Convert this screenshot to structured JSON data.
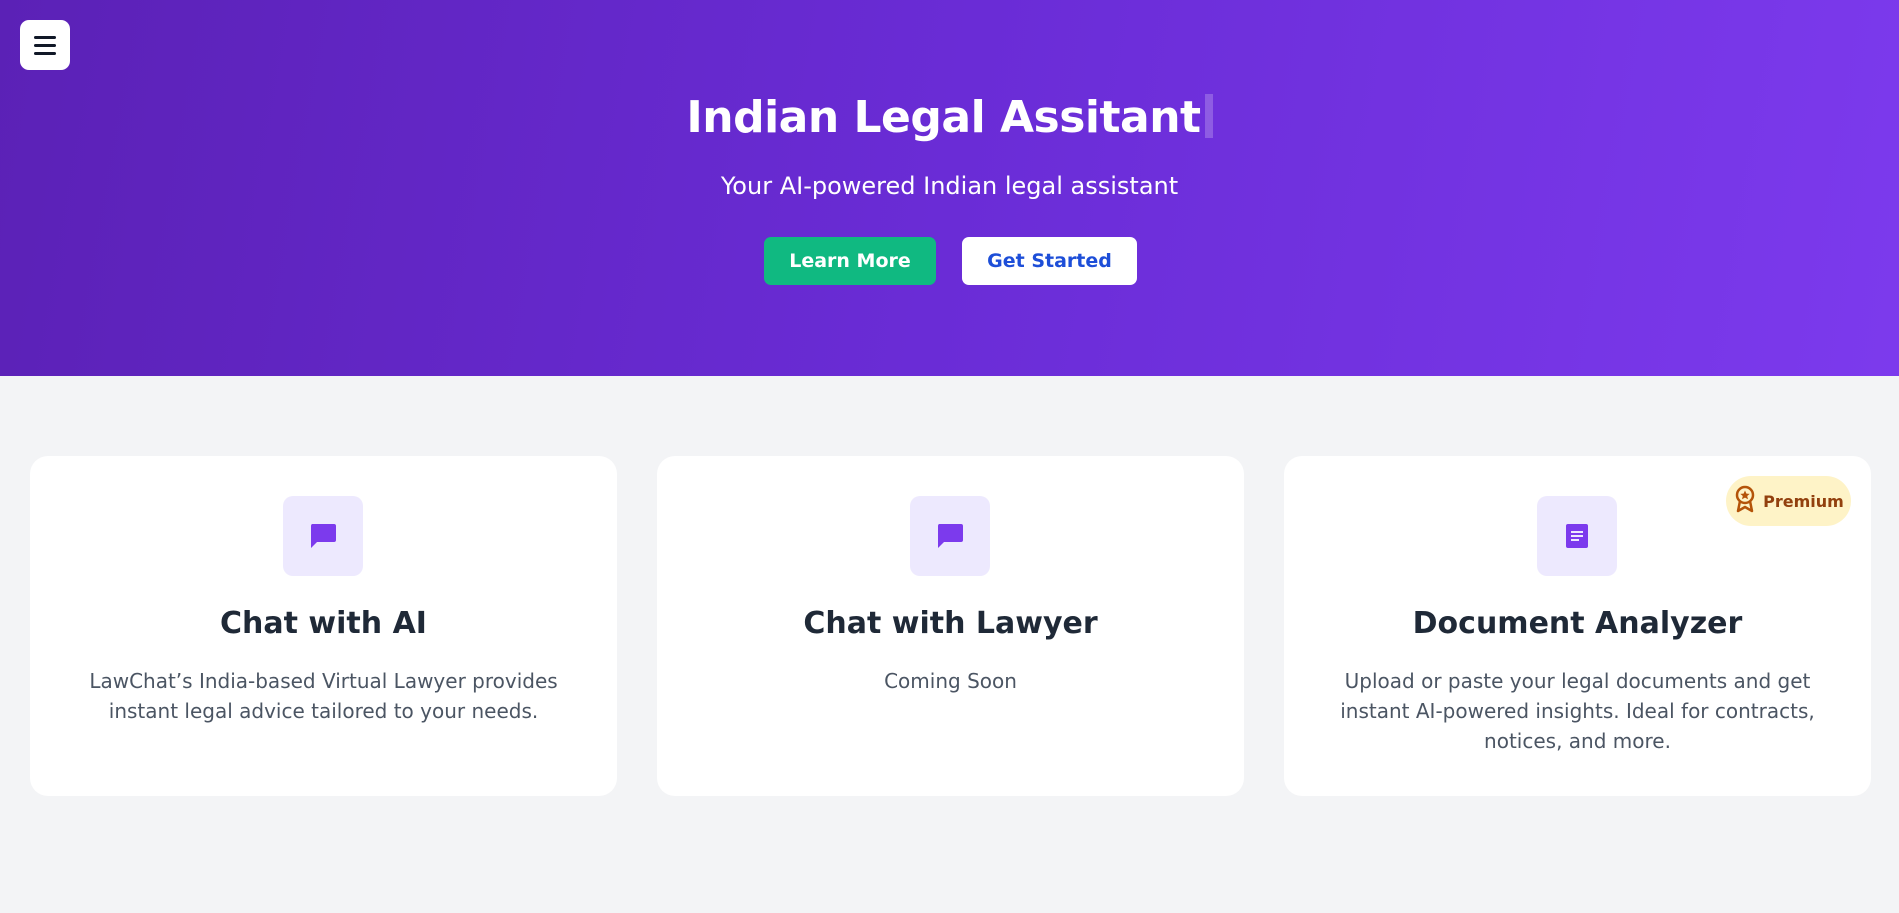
{
  "header": {
    "menu_icon": "hamburger-menu-icon",
    "title": "Indian Legal Assitant",
    "subtitle": "Your AI-powered Indian legal assistant",
    "learn_more_label": "Learn More",
    "get_started_label": "Get Started"
  },
  "colors": {
    "hero_gradient_start": "#5b21b6",
    "hero_gradient_end": "#7c3aed",
    "learn_more_bg": "#10b981",
    "get_started_text": "#1d4ed8",
    "icon_bg": "#ede9fe",
    "icon_color": "#7c3aed",
    "premium_bg": "#fef3c7",
    "premium_text": "#92400e"
  },
  "cards": [
    {
      "icon": "chat-bubble-icon",
      "title": "Chat with AI",
      "description_lines": [
        "LawChat’s India-based Virtual Lawyer provides",
        "instant legal advice tailored to your needs."
      ]
    },
    {
      "icon": "chat-bubble-icon",
      "title": "Chat with Lawyer",
      "description_lines": [
        "Coming Soon"
      ]
    },
    {
      "icon": "document-icon",
      "title": "Document Analyzer",
      "badge": {
        "icon": "award-icon",
        "label": "Premium"
      },
      "description_lines": [
        "Upload or paste your legal documents and get",
        "instant AI-powered insights. Ideal for contracts,",
        "notices, and more."
      ]
    }
  ]
}
